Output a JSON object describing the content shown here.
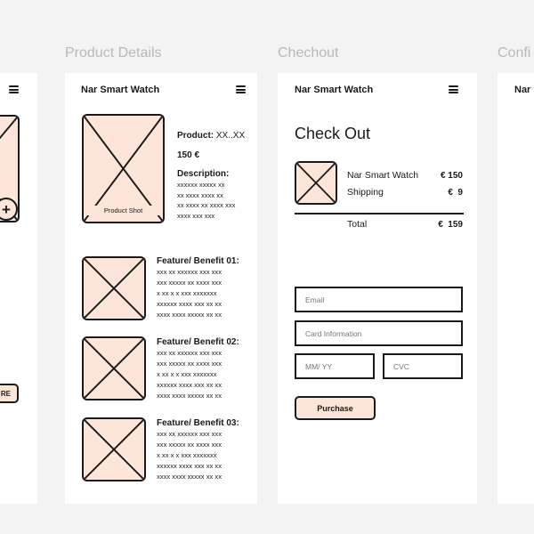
{
  "frames": {
    "left": {
      "button_label": "RE"
    },
    "product": {
      "title": "Product Details",
      "app_name": "Nar Smart Watch",
      "product_label": "Product:",
      "product_value": "XX..XX",
      "price": "150 €",
      "description_label": "Description:",
      "description_text": "xxxxxx xxxxx xx\nxx xxxx xxxx xx\nxx xxxx xx xxxx xxx\nxxxx xxx xxx",
      "shot_label": "Product Shot",
      "features": [
        {
          "title": "Feature/ Benefit 01:",
          "text": "xxx xx xxxxxx xxx xxx\nxxx xxxxx xx xxxx xxx\nx xx x x xxx xxxxxxx\nxxxxxx xxxx xxx xx xx\nxxxx xxxx xxxxx xx xx"
        },
        {
          "title": "Feature/ Benefit 02:",
          "text": "xxx xx xxxxxx xxx xxx\nxxx xxxxx xx xxxx xxx\nx xx x x xxx xxxxxxx\nxxxxxx xxxx xxx xx xx\nxxxx xxxx xxxxx xx xx"
        },
        {
          "title": "Feature/ Benefit 03:",
          "text": "xxx xx xxxxxx xxx xxx\nxxx xxxxx xx xxxx xxx\nx xx x x xxx xxxxxxx\nxxxxxx xxxx xxx xx xx\nxxxx xxxx xxxxx xx xx"
        }
      ]
    },
    "checkout": {
      "title": "Chechout",
      "app_name": "Nar Smart Watch",
      "heading": "Check Out",
      "item_name": "Nar Smart Watch",
      "item_price": "€ 150",
      "shipping_label": "Shipping",
      "shipping_price": "€  9",
      "total_label": "Total",
      "total_price": "€  159",
      "email_placeholder": "Email",
      "card_placeholder": "Card Information",
      "expiry_placeholder": "MM/ YY",
      "cvc_placeholder": "CVC",
      "purchase_label": "Purchase"
    },
    "confirm": {
      "title": "Confi",
      "app_name": "Nar"
    }
  }
}
